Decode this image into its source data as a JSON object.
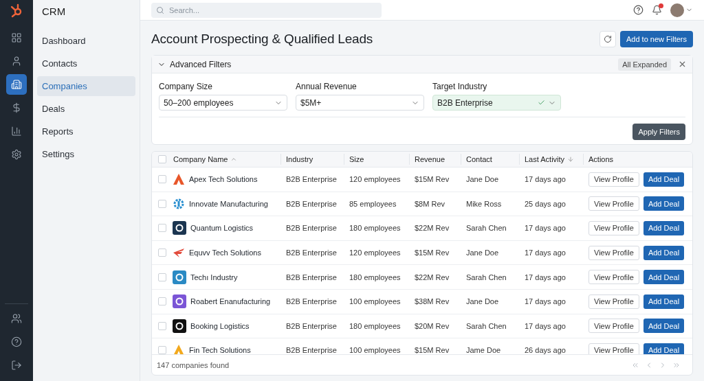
{
  "rail": {
    "top": [
      {
        "selected": false
      },
      {
        "selected": false
      },
      {
        "selected": true
      },
      {
        "selected": false
      },
      {
        "selected": false
      },
      {
        "selected": false
      }
    ],
    "bottom": [
      {
        "selected": false
      },
      {
        "selected": false
      },
      {
        "selected": false
      }
    ]
  },
  "sidebar": {
    "title": "CRM",
    "items": [
      {
        "label": "Dashboard",
        "selected": false
      },
      {
        "label": "Contacts",
        "selected": false
      },
      {
        "label": "Companies",
        "selected": true
      },
      {
        "label": "Deals",
        "selected": false
      },
      {
        "label": "Reports",
        "selected": false
      },
      {
        "label": "Settings",
        "selected": false
      }
    ]
  },
  "topbar": {
    "search": {
      "placeholder": "Search..."
    },
    "notifications": {
      "unread": true
    }
  },
  "page": {
    "title": "Account Prospecting & Qualified Leads",
    "primary_button": "Add to new Filters"
  },
  "filters": {
    "title": "Advanced Filters",
    "expanded": true,
    "badge": "All Expanded",
    "apply_button": "Apply Filters",
    "fields": [
      {
        "label": "Company Size",
        "value": "50–200 employees",
        "valid": false
      },
      {
        "label": "Annual Revenue",
        "value": "$5M+",
        "valid": false
      },
      {
        "label": "Target Industry",
        "value": "B2B Enterprise",
        "valid": true
      }
    ]
  },
  "table": {
    "select_all": {
      "checked": false
    },
    "columns": [
      {
        "label": "Company Name",
        "kind": "sort-asc"
      },
      {
        "label": "Industry",
        "kind": "plain"
      },
      {
        "label": "Size",
        "kind": "plain"
      },
      {
        "label": "Revenue",
        "kind": "plain"
      },
      {
        "label": "Contact",
        "kind": "plain"
      },
      {
        "label": "Last Activity",
        "kind": "sort-desc"
      },
      {
        "label": "Actions",
        "kind": "plain"
      }
    ],
    "rows": [
      {
        "checked": false,
        "logo": {
          "kind": "triangle",
          "color": "#e8572a"
        },
        "company": "Apex Tech Solutions",
        "industry": "B2B Enterprise",
        "size": "120 employees",
        "revenue": "$15M Rev",
        "contact": "Jane Doe",
        "activity": "17 days ago",
        "view": "View Profile",
        "add": "Add Deal"
      },
      {
        "checked": false,
        "logo": {
          "kind": "gear",
          "color": "#2a8fd0"
        },
        "company": "Innovate Manufacturing",
        "industry": "B2B Enterprise",
        "size": "85 employees",
        "revenue": "$8M Rev",
        "contact": "Mike Ross",
        "activity": "25 days ago",
        "view": "View Profile",
        "add": "Add Deal"
      },
      {
        "checked": false,
        "logo": {
          "kind": "tile",
          "color": "#1b3550"
        },
        "company": "Quantum Logistics",
        "industry": "B2B Enterprise",
        "size": "180 employees",
        "revenue": "$22M Rev",
        "contact": "Sarah Chen",
        "activity": "17 days ago",
        "view": "View Profile",
        "add": "Add Deal"
      },
      {
        "checked": false,
        "logo": {
          "kind": "wing",
          "color": "#e24a3b"
        },
        "company": "Equvv Tech Solutions",
        "industry": "B2B Enterprise",
        "size": "120 employees",
        "revenue": "$15M Rev",
        "contact": "Jane Doe",
        "activity": "17 days ago",
        "view": "View Profile",
        "add": "Add Deal"
      },
      {
        "checked": false,
        "logo": {
          "kind": "tile",
          "color": "#2a8ac4"
        },
        "company": "Techı Industry",
        "industry": "B2B Enterprise",
        "size": "180 employees",
        "revenue": "$22M Rev",
        "contact": "Sarah Chen",
        "activity": "17 days ago",
        "view": "View Profile",
        "add": "Add Deal"
      },
      {
        "checked": false,
        "logo": {
          "kind": "tile",
          "color": "#7b55d6"
        },
        "company": "Roabert Enanufacturing",
        "industry": "B2B Enterprise",
        "size": "100 employees",
        "revenue": "$38M Rev",
        "contact": "Jane Doe",
        "activity": "17 days ago",
        "view": "View Profile",
        "add": "Add Deal"
      },
      {
        "checked": false,
        "logo": {
          "kind": "tile",
          "color": "#111111"
        },
        "company": "Booking Logistics",
        "industry": "B2B Enterprise",
        "size": "180 employees",
        "revenue": "$20M Rev",
        "contact": "Sarah Chen",
        "activity": "17 days ago",
        "view": "View Profile",
        "add": "Add Deal"
      },
      {
        "checked": false,
        "logo": {
          "kind": "triangle",
          "color": "#f2a91e"
        },
        "company": "Fin Tech Solutions",
        "industry": "B2B Enterprise",
        "size": "100 employees",
        "revenue": "$15M Rev",
        "contact": "Jame Doe",
        "activity": "26 days ago",
        "view": "View Profile",
        "add": "Add Deal"
      }
    ],
    "footer": "147 companies found"
  }
}
